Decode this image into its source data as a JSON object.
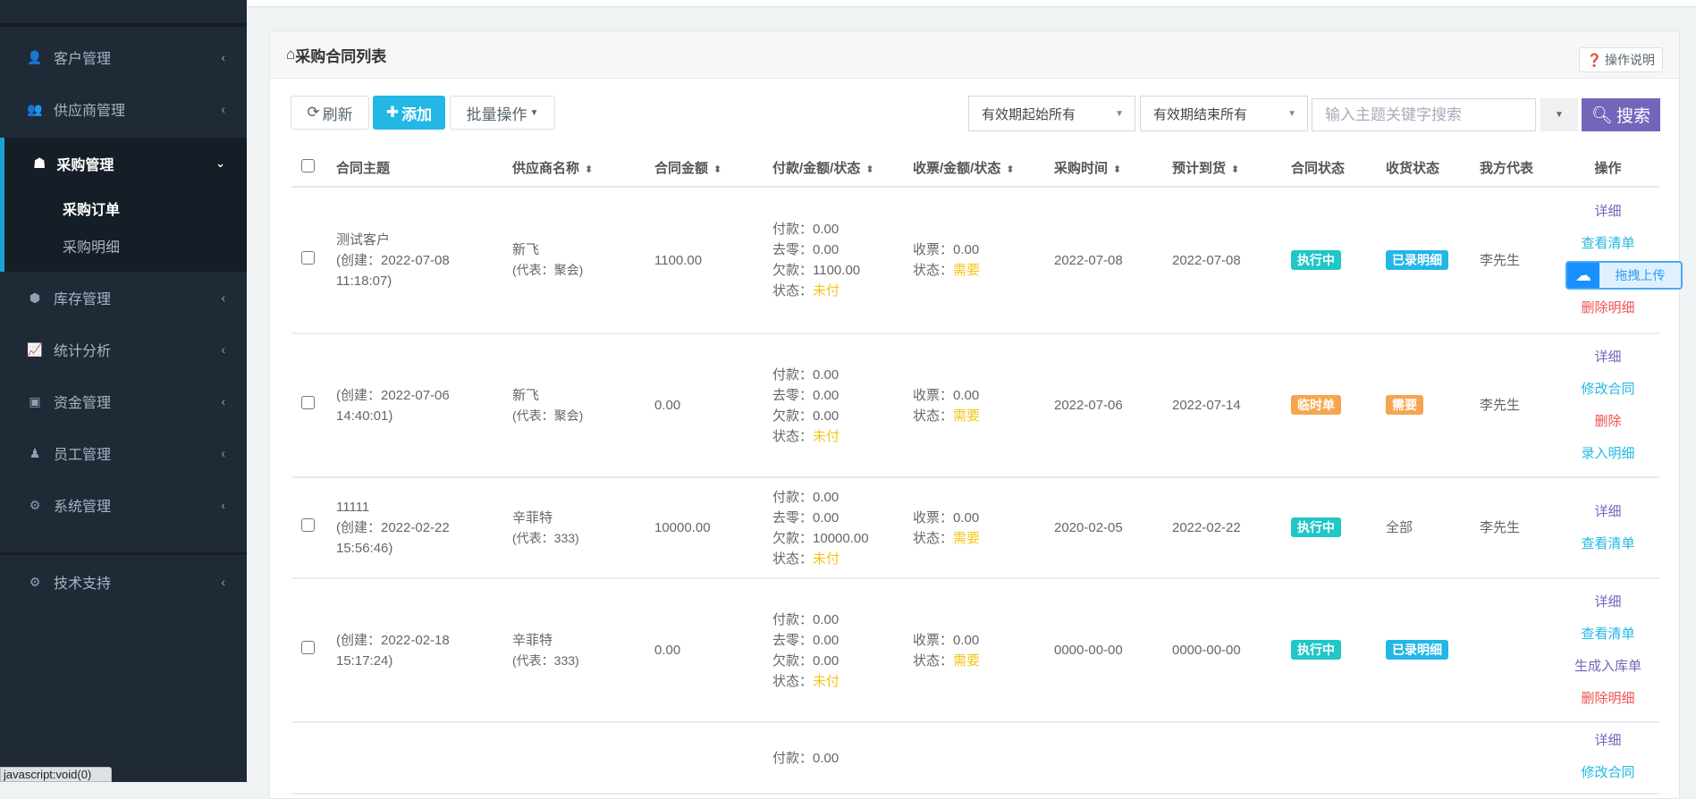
{
  "sidebar": {
    "items": [
      {
        "label": "客户管理",
        "icon": "user-icon",
        "glyph": "👤"
      },
      {
        "label": "供应商管理",
        "icon": "users-icon",
        "glyph": "👥"
      }
    ],
    "active": {
      "label": "采购管理",
      "icon": "user-secret-icon",
      "glyph": "☗",
      "sub": [
        {
          "label": "采购订单",
          "selected": true
        },
        {
          "label": "采购明细",
          "selected": false
        }
      ]
    },
    "items_after": [
      {
        "label": "库存管理",
        "icon": "cube-icon",
        "glyph": "⬢"
      },
      {
        "label": "统计分析",
        "icon": "line-chart-icon",
        "glyph": "📈"
      },
      {
        "label": "资金管理",
        "icon": "money-icon",
        "glyph": "▣"
      },
      {
        "label": "员工管理",
        "icon": "employee-icon",
        "glyph": "♟"
      },
      {
        "label": "系统管理",
        "icon": "cogs-icon",
        "glyph": "⚙"
      }
    ],
    "support": {
      "label": "技术支持",
      "icon": "cogs-icon",
      "glyph": "⚙"
    }
  },
  "card": {
    "title": "采购合同列表",
    "help_label": "操作说明"
  },
  "toolbar": {
    "refresh": "刷新",
    "add": "添加",
    "batch": "批量操作"
  },
  "filters": {
    "start": "有效期起始所有",
    "end": "有效期结束所有",
    "search_placeholder": "输入主题关键字搜索",
    "search_button": "搜索"
  },
  "table": {
    "headers": [
      "合同主题",
      "供应商名称",
      "合同金额",
      "付款/金额/状态",
      "收票/金额/状态",
      "采购时间",
      "预计到货",
      "合同状态",
      "收货状态",
      "我方代表",
      "操作"
    ],
    "labels": {
      "paid": "付款：",
      "rounding": "去零：",
      "owed": "欠款：",
      "status": "状态：",
      "invoice": "收票："
    },
    "rows": [
      {
        "subject": "测试客户",
        "created": "(创建：2022-07-08",
        "created_time": "11:18:07)",
        "supplier": "新飞",
        "rep": "(代表：聚会)",
        "amount": "1100.00",
        "paid": "0.00",
        "rounding": "0.00",
        "owed": "1100.00",
        "pay_status": "未付",
        "invoice": "0.00",
        "inv_status": "需要",
        "purchase_date": "2022-07-08",
        "arrival_date": "2022-07-08",
        "contract_status": {
          "label": "执行中",
          "color": "#1fc7c6"
        },
        "receipt_status": {
          "label": "已录明细",
          "color": "#23b7e5"
        },
        "our_rep": "李先生",
        "actions": [
          {
            "label": "详细",
            "color": "#7266ba"
          },
          {
            "label": "查看清单",
            "color": "#23b7e5"
          },
          {
            "label": "",
            "color": ""
          },
          {
            "label": "删除明细",
            "color": "#f05050"
          }
        ]
      },
      {
        "subject": "",
        "created": "(创建：2022-07-06",
        "created_time": "14:40:01)",
        "supplier": "新飞",
        "rep": "(代表：聚会)",
        "amount": "0.00",
        "paid": "0.00",
        "rounding": "0.00",
        "owed": "0.00",
        "pay_status": "未付",
        "invoice": "0.00",
        "inv_status": "需要",
        "purchase_date": "2022-07-06",
        "arrival_date": "2022-07-14",
        "contract_status": {
          "label": "临时单",
          "color": "#f6a54f"
        },
        "receipt_status": {
          "label": "需要",
          "color": "#f6a54f"
        },
        "our_rep": "李先生",
        "actions": [
          {
            "label": "详细",
            "color": "#7266ba"
          },
          {
            "label": "修改合同",
            "color": "#23b7e5"
          },
          {
            "label": "删除",
            "color": "#f05050"
          },
          {
            "label": "录入明细",
            "color": "#23b7e5"
          }
        ]
      },
      {
        "subject": "11111",
        "created": "(创建：2022-02-22",
        "created_time": "15:56:46)",
        "supplier": "辛菲特",
        "rep": "(代表：333)",
        "amount": "10000.00",
        "paid": "0.00",
        "rounding": "0.00",
        "owed": "10000.00",
        "pay_status": "未付",
        "invoice": "0.00",
        "inv_status": "需要",
        "purchase_date": "2020-02-05",
        "arrival_date": "2022-02-22",
        "contract_status": {
          "label": "执行中",
          "color": "#1fc7c6"
        },
        "receipt_status": {
          "label": "全部",
          "color": ""
        },
        "our_rep": "李先生",
        "actions": [
          {
            "label": "详细",
            "color": "#7266ba"
          },
          {
            "label": "查看清单",
            "color": "#23b7e5"
          }
        ]
      },
      {
        "subject": "",
        "created": "(创建：2022-02-18",
        "created_time": "15:17:24)",
        "supplier": "辛菲特",
        "rep": "(代表：333)",
        "amount": "0.00",
        "paid": "0.00",
        "rounding": "0.00",
        "owed": "0.00",
        "pay_status": "未付",
        "invoice": "0.00",
        "inv_status": "需要",
        "purchase_date": "0000-00-00",
        "arrival_date": "0000-00-00",
        "contract_status": {
          "label": "执行中",
          "color": "#1fc7c6"
        },
        "receipt_status": {
          "label": "已录明细",
          "color": "#23b7e5"
        },
        "our_rep": "",
        "actions": [
          {
            "label": "详细",
            "color": "#7266ba"
          },
          {
            "label": "查看清单",
            "color": "#23b7e5"
          },
          {
            "label": "生成入库单",
            "color": "#7266ba"
          },
          {
            "label": "删除明细",
            "color": "#f05050"
          }
        ]
      }
    ],
    "partial_row": {
      "paid": "0.00",
      "actions": [
        {
          "label": "详细",
          "color": "#7266ba"
        },
        {
          "label": "修改合同",
          "color": "#23b7e5"
        }
      ]
    }
  },
  "upload_widget": {
    "label": "拖拽上传"
  },
  "status_tooltip": "javascript:void(0)"
}
